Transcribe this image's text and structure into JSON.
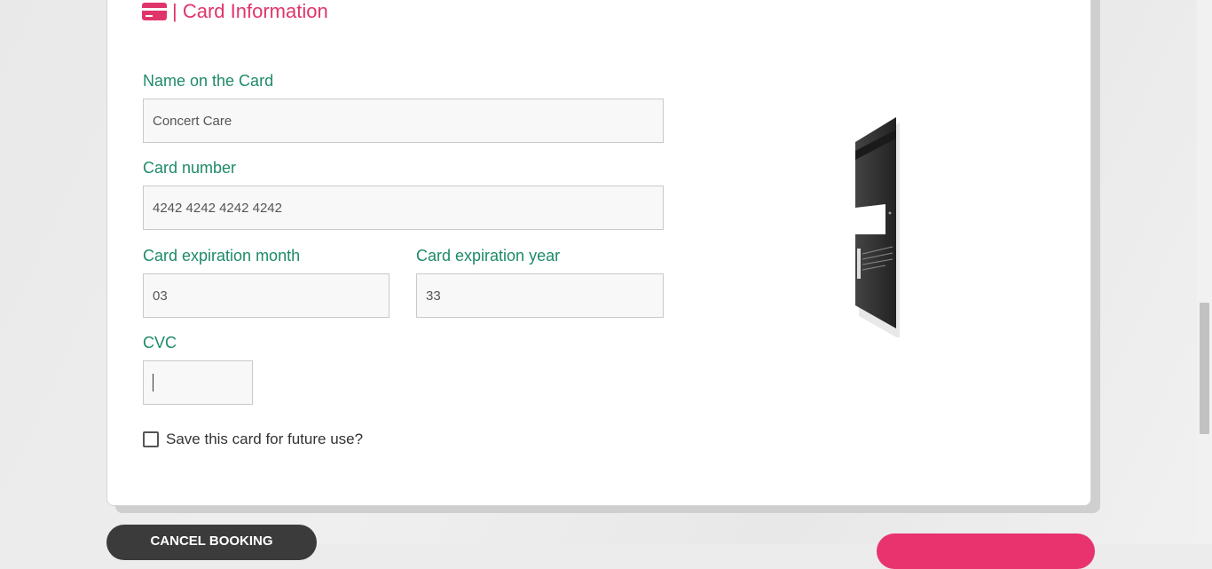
{
  "section": {
    "title": "| Card Information",
    "icon": "credit-card-icon"
  },
  "form": {
    "name_label": "Name on the Card",
    "name_value": "Concert Care",
    "number_label": "Card number",
    "number_value": "4242 4242 4242 4242",
    "exp_month_label": "Card expiration month",
    "exp_month_value": "03",
    "exp_year_label": "Card expiration year",
    "exp_year_value": "33",
    "cvc_label": "CVC",
    "cvc_value": ""
  },
  "save_card_label": "Save this card for future use?",
  "buttons": {
    "cancel": "CANCEL BOOKING"
  },
  "colors": {
    "accent": "#e0356b",
    "label": "#1e8a6a",
    "cancel_bg": "#3b3b3b"
  }
}
